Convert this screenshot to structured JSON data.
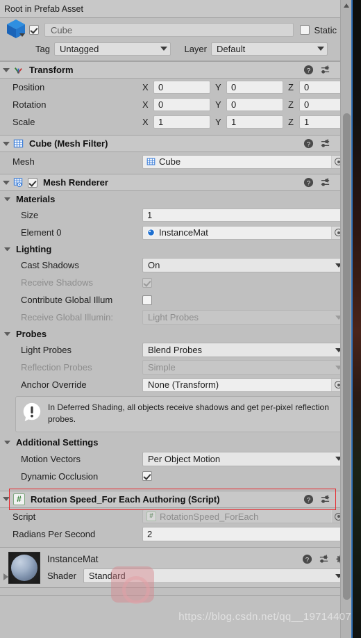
{
  "breadcrumb": {
    "text": "Root in Prefab Asset"
  },
  "object_header": {
    "icon": "prefab-cube-icon",
    "enabled": true,
    "name": "Cube",
    "static_label": "Static",
    "static_checked": false,
    "tag_label": "Tag",
    "tag_value": "Untagged",
    "layer_label": "Layer",
    "layer_value": "Default"
  },
  "components": [
    {
      "id": "transform",
      "title": "Transform",
      "icon": "transform-axes-icon",
      "rows": [
        {
          "label": "Position",
          "x": "0",
          "y": "0",
          "z": "0"
        },
        {
          "label": "Rotation",
          "x": "0",
          "y": "0",
          "z": "0"
        },
        {
          "label": "Scale",
          "x": "1",
          "y": "1",
          "z": "1"
        }
      ],
      "axis_labels": {
        "x": "X",
        "y": "Y",
        "z": "Z"
      }
    },
    {
      "id": "mesh-filter",
      "title": "Cube (Mesh Filter)",
      "icon": "mesh-filter-icon",
      "mesh_label": "Mesh",
      "mesh_value": "Cube"
    },
    {
      "id": "mesh-renderer",
      "title": "Mesh Renderer",
      "icon": "mesh-renderer-icon",
      "enabled": true,
      "sections": {
        "materials": {
          "title": "Materials",
          "size_label": "Size",
          "size_value": "1",
          "element_label": "Element 0",
          "element_value": "InstanceMat"
        },
        "lighting": {
          "title": "Lighting",
          "cast_shadows_label": "Cast Shadows",
          "cast_shadows_value": "On",
          "receive_shadows_label": "Receive Shadows",
          "receive_shadows_checked": true,
          "contribute_gi_label": "Contribute Global Illum",
          "contribute_gi_checked": false,
          "receive_gi_label": "Receive Global Illumin:",
          "receive_gi_value": "Light Probes"
        },
        "probes": {
          "title": "Probes",
          "light_probes_label": "Light Probes",
          "light_probes_value": "Blend Probes",
          "reflection_probes_label": "Reflection Probes",
          "reflection_probes_value": "Simple",
          "anchor_override_label": "Anchor Override",
          "anchor_override_value": "None (Transform)"
        },
        "info": {
          "icon": "warning-info-icon",
          "text": "In Deferred Shading, all objects receive shadows and get per-pixel reflection probes."
        },
        "additional": {
          "title": "Additional Settings",
          "motion_vectors_label": "Motion Vectors",
          "motion_vectors_value": "Per Object Motion",
          "dynamic_occlusion_label": "Dynamic Occlusion",
          "dynamic_occlusion_checked": true
        }
      }
    },
    {
      "id": "rotation-speed-script",
      "title": "Rotation Speed_For Each Authoring (Script)",
      "icon": "cs-script-icon",
      "highlighted": true,
      "highlight_color": "#e8262b",
      "script_label": "Script",
      "script_value": "RotationSpeed_ForEach",
      "radians_label": "Radians Per Second",
      "radians_value": "2"
    }
  ],
  "material_footer": {
    "name": "InstanceMat",
    "preview_icon": "material-sphere-preview",
    "shader_label": "Shader",
    "shader_value": "Standard"
  },
  "header_icons": {
    "help": "help-icon",
    "preset": "preset-settings-icon",
    "menu": "kebab-menu-icon",
    "gear": "gear-icon"
  },
  "watermark": {
    "text": "https://blog.csdn.net/qq__19714407"
  },
  "colors": {
    "panel": "#c0c0c0",
    "header": "#c8c8c8",
    "field": "#eeeeee",
    "accent_blue": "#2f6fb5",
    "highlight_red": "#e8262b",
    "script_green": "#2f7d32"
  }
}
